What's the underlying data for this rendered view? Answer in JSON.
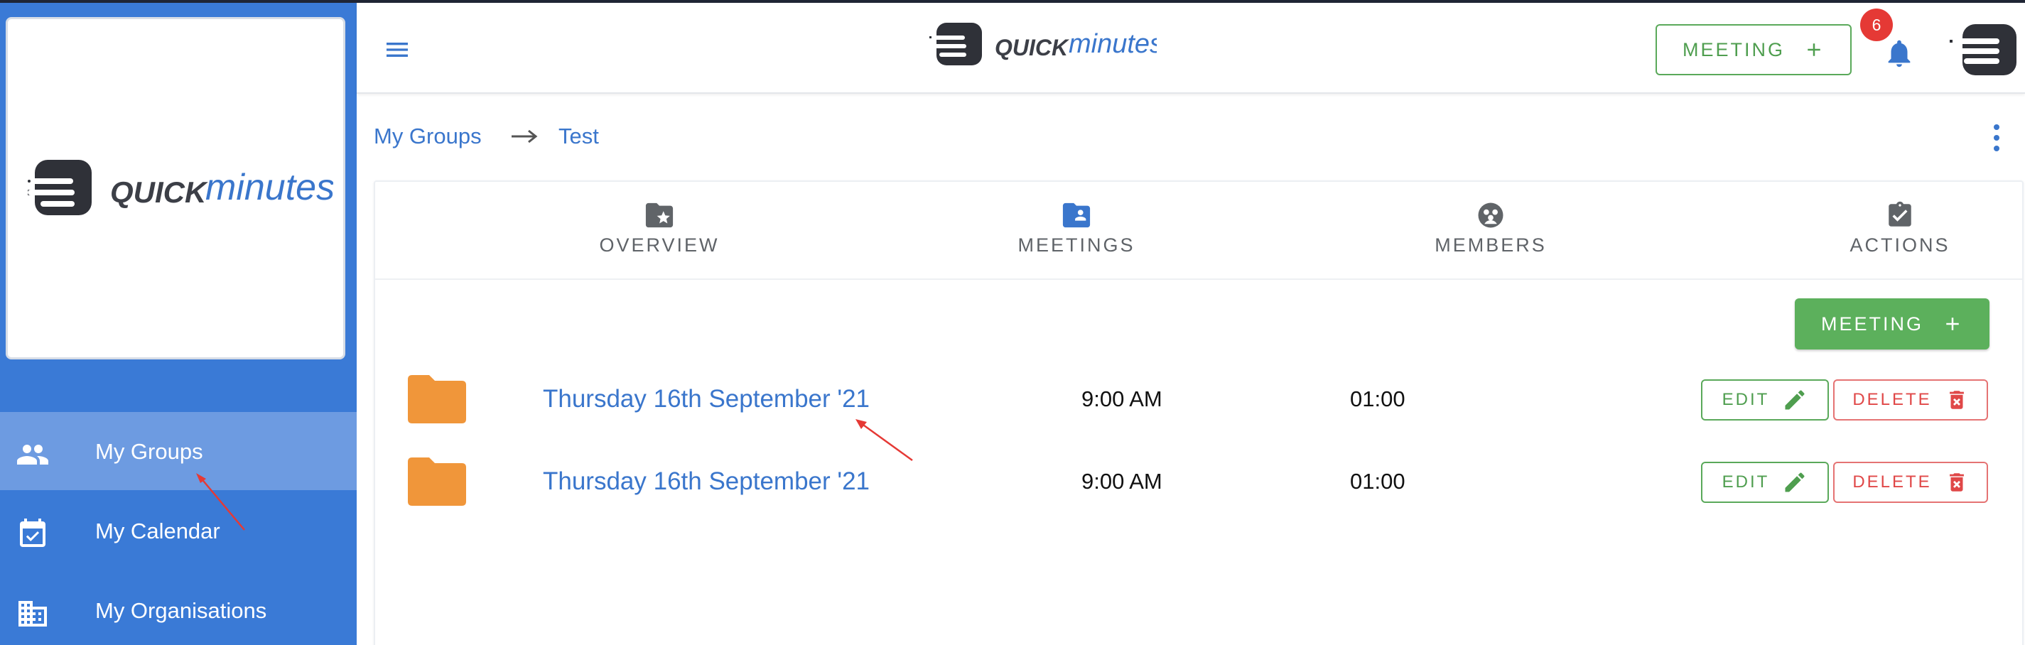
{
  "app": {
    "brand_dark": "QUICK",
    "brand_light": "minutes",
    "brand_dark_color": "#3c3f47",
    "brand_light_color": "#3a76cc"
  },
  "sidebar": {
    "background": "#3a7ad6",
    "items": [
      {
        "label": "My Groups",
        "icon": "people-icon",
        "active": true
      },
      {
        "label": "My Calendar",
        "icon": "calendar-check-icon",
        "active": false
      },
      {
        "label": "My Organisations",
        "icon": "building-icon",
        "active": false
      }
    ]
  },
  "header": {
    "meeting_button_label": "MEETING",
    "notification_count": "6"
  },
  "breadcrumb": {
    "root": "My Groups",
    "current": "Test"
  },
  "tabs": [
    {
      "label": "OVERVIEW",
      "icon": "folder-star-icon",
      "active": false
    },
    {
      "label": "MEETINGS",
      "icon": "folder-account-icon",
      "active": true
    },
    {
      "label": "MEMBERS",
      "icon": "members-icon",
      "active": false
    },
    {
      "label": "ACTIONS",
      "icon": "clipboard-check-icon",
      "active": false
    }
  ],
  "meetings": {
    "add_button_label": "MEETING",
    "edit_label": "EDIT",
    "delete_label": "DELETE",
    "rows": [
      {
        "title": "Thursday 16th September '21",
        "time": "9:00 AM",
        "duration": "01:00"
      },
      {
        "title": "Thursday 16th September '21",
        "time": "9:00 AM",
        "duration": "01:00"
      }
    ]
  },
  "colors": {
    "accent_blue": "#3a76cc",
    "success_green": "#5cb05c",
    "danger_red": "#e04848",
    "folder_orange": "#f0963a",
    "badge_red": "#e53935"
  }
}
